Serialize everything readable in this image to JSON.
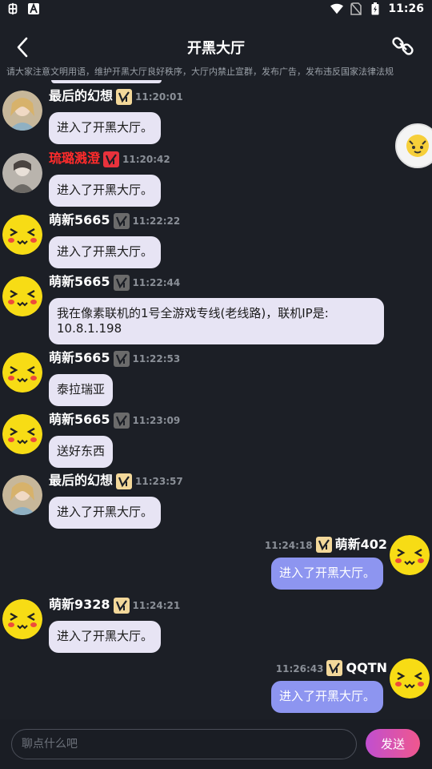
{
  "status_bar": {
    "left_icons": [
      "bug-icon",
      "a-badge-icon"
    ],
    "time": "11:26",
    "right_icons": [
      "wifi-icon",
      "no-sim-icon",
      "battery-icon"
    ]
  },
  "header": {
    "title": "开黑大厅",
    "back_icon": "back-icon",
    "link_icon": "link-icon"
  },
  "notice": "请大家注意文明用语，维护开黑大厅良好秩序，大厅内禁止宣群，发布广告，发布违反国家法律法规",
  "messages": [
    {
      "side": "left",
      "avatar": "photo-girl",
      "nick": "最后的幻想",
      "nick_color": "#ffffff",
      "badge": "gold",
      "time": "11:20:01",
      "text": "进入了开黑大厅。"
    },
    {
      "side": "left",
      "avatar": "photo-anime",
      "nick": "琉璐溅澄",
      "nick_color": "#ff2b2b",
      "badge": "red",
      "time": "11:20:42",
      "text": "进入了开黑大厅。"
    },
    {
      "side": "left",
      "avatar": "yellow-face",
      "nick": "萌新5665",
      "nick_color": "#ffffff",
      "badge": "gray",
      "time": "11:22:22",
      "text": "进入了开黑大厅。"
    },
    {
      "side": "left",
      "avatar": "yellow-face",
      "nick": "萌新5665",
      "nick_color": "#ffffff",
      "badge": "gray",
      "time": "11:22:44",
      "text_lines": [
        "我在像素联机的1号全游戏专线(老线路)，联机IP是:",
        "10.8.1.198"
      ]
    },
    {
      "side": "left",
      "avatar": "yellow-face",
      "nick": "萌新5665",
      "nick_color": "#ffffff",
      "badge": "gray",
      "time": "11:22:53",
      "text": "泰拉瑞亚"
    },
    {
      "side": "left",
      "avatar": "yellow-face",
      "nick": "萌新5665",
      "nick_color": "#ffffff",
      "badge": "gray",
      "time": "11:23:09",
      "text": "送好东西"
    },
    {
      "side": "left",
      "avatar": "photo-girl",
      "nick": "最后的幻想",
      "nick_color": "#ffffff",
      "badge": "gold",
      "time": "11:23:57",
      "text": "进入了开黑大厅。"
    },
    {
      "side": "right",
      "avatar": "yellow-face",
      "nick": "萌新402",
      "nick_color": "#ffffff",
      "badge": "gold",
      "time": "11:24:18",
      "text": "进入了开黑大厅。"
    },
    {
      "side": "left",
      "avatar": "yellow-face",
      "nick": "萌新9328",
      "nick_color": "#ffffff",
      "badge": "gold",
      "time": "11:24:21",
      "text": "进入了开黑大厅。"
    },
    {
      "side": "right",
      "avatar": "yellow-face",
      "nick": "QQTN",
      "nick_color": "#ffffff",
      "badge": "gold",
      "time": "11:26:43",
      "text": "进入了开黑大厅。"
    }
  ],
  "input": {
    "placeholder": "聊点什么吧",
    "send_label": "发送"
  },
  "colors": {
    "background": "#1c1f26",
    "bubble_left": "#e7e4f4",
    "bubble_right": "#8d95f0",
    "badge_gold": "#f3d89a",
    "badge_gray": "#6b6b6b",
    "badge_red": "#e8323c",
    "send_gradient_start": "#c04fd0",
    "send_gradient_end": "#f0578e"
  }
}
